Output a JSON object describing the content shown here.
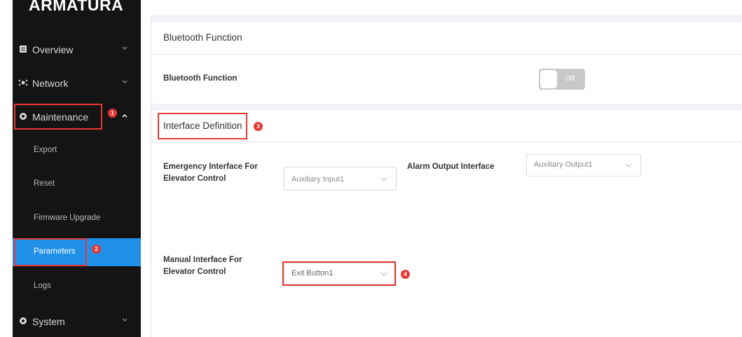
{
  "sidebar": {
    "logo": "ARMATURA",
    "items": [
      {
        "label": "Overview",
        "icon": "document-icon"
      },
      {
        "label": "Network",
        "icon": "network-icon"
      },
      {
        "label": "Maintenance",
        "icon": "maintenance-icon"
      },
      {
        "label": "System",
        "icon": "gear-icon"
      }
    ],
    "maintenance_sub": [
      "Export",
      "Reset",
      "Firmware Upgrade",
      "Parameters",
      "Logs"
    ]
  },
  "annotations": {
    "step1": "1",
    "step2": "2",
    "step3": "3",
    "step4": "4",
    "color": "#e53935"
  },
  "bluetooth": {
    "section_title": "Bluetooth Function",
    "label": "Bluetooth Function",
    "toggle_state": "Off"
  },
  "interface": {
    "section_title": "Interface Definition",
    "emergency_label_1": "Emergency Interface For",
    "emergency_label_2": "Elevator Control",
    "emergency_value": "Auxiliary Input1",
    "alarm_label": "Alarm Output Interface",
    "alarm_value": "Auxiliary Output1",
    "manual_label_1": "Manual Interface For",
    "manual_label_2": "Elevator Control",
    "manual_value": "Exit Button1"
  },
  "colors": {
    "accent": "#1f8fe8",
    "sidebar_bg": "#141414"
  }
}
